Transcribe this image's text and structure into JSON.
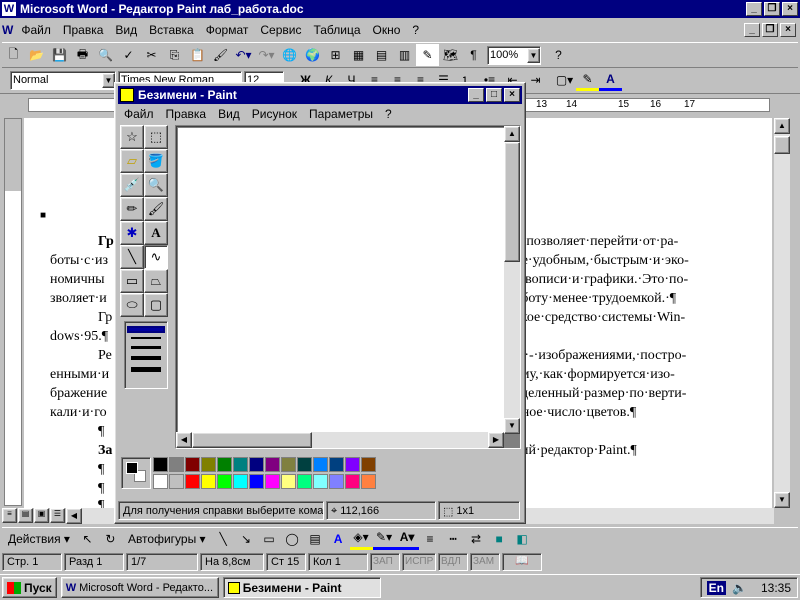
{
  "word": {
    "title": "Microsoft Word - Редактор Paint лаб_работа.doc",
    "menu": [
      "Файл",
      "Правка",
      "Вид",
      "Вставка",
      "Формат",
      "Сервис",
      "Таблица",
      "Окно",
      "?"
    ],
    "zoom": "100%",
    "style": "Normal",
    "font": "Times New Roman",
    "size": "12",
    "ruler_nums": [
      "13",
      "14",
      "15",
      "16",
      "17"
    ],
    "doc_lines": {
      "l1a": "Гр",
      "l1b": "рая·позволяет·перейти·от·ра-",
      "l2a": "боты·с·из",
      "l2b": "нее·удобным,·быстрым·и·эко-",
      "l3a": "номичны",
      "l3b": "живописи·и·графики.·Это·по-",
      "l4a": "зволяет·и",
      "l4b": "работу·менее·трудоемкой.·¶",
      "l5a": "Гр",
      "l5b": "еское·средство·системы·Win-",
      "l6a": "dows·95.¶",
      "l7a": "Ре",
      "l7b": "ми·-·изображениями,·постро-",
      "l8a": "енными·и",
      "l8b": "тому,·как·формируется·изо-",
      "l9a": "бражение",
      "l9b": "ределенный·размер·по·верти-",
      "l10a": "кали·и·го",
      "l10b": "анное·число·цветов.¶",
      "l11a": "¶",
      "l12a": "За",
      "l12b": "ский·редактор·Paint.¶",
      "l13a": "¶",
      "l14a": "¶",
      "l15a": "¶"
    },
    "drawing_bar": {
      "actions": "Действия ▾",
      "autoshapes": "Автофигуры ▾"
    },
    "status": {
      "page": "Стр. 1",
      "section": "Разд 1",
      "pages": "1/7",
      "at": "На 8,8см",
      "line": "Ст 15",
      "col": "Кол 1",
      "rec": "ЗАП",
      "trk": "ИСПР",
      "ext": "ВДЛ",
      "ovr": "ЗАМ"
    }
  },
  "paint": {
    "title": "Безимени - Paint",
    "menu": [
      "Файл",
      "Правка",
      "Вид",
      "Рисунок",
      "Параметры",
      "?"
    ],
    "status_help": "Для получения справки выберите кома",
    "coords": "112,166",
    "size": "1x1",
    "palette_top": [
      "#000000",
      "#808080",
      "#800000",
      "#808000",
      "#008000",
      "#008080",
      "#000080",
      "#800080",
      "#808040",
      "#004040",
      "#0080ff",
      "#004080",
      "#8000ff",
      "#804000"
    ],
    "palette_bottom": [
      "#ffffff",
      "#c0c0c0",
      "#ff0000",
      "#ffff00",
      "#00ff00",
      "#00ffff",
      "#0000ff",
      "#ff00ff",
      "#ffff80",
      "#00ff80",
      "#80ffff",
      "#8080ff",
      "#ff0080",
      "#ff8040"
    ]
  },
  "taskbar": {
    "start": "Пуск",
    "task1": "Microsoft Word - Редакто...",
    "task2": "Безимени - Paint",
    "lang": "En",
    "time": "13:35"
  }
}
